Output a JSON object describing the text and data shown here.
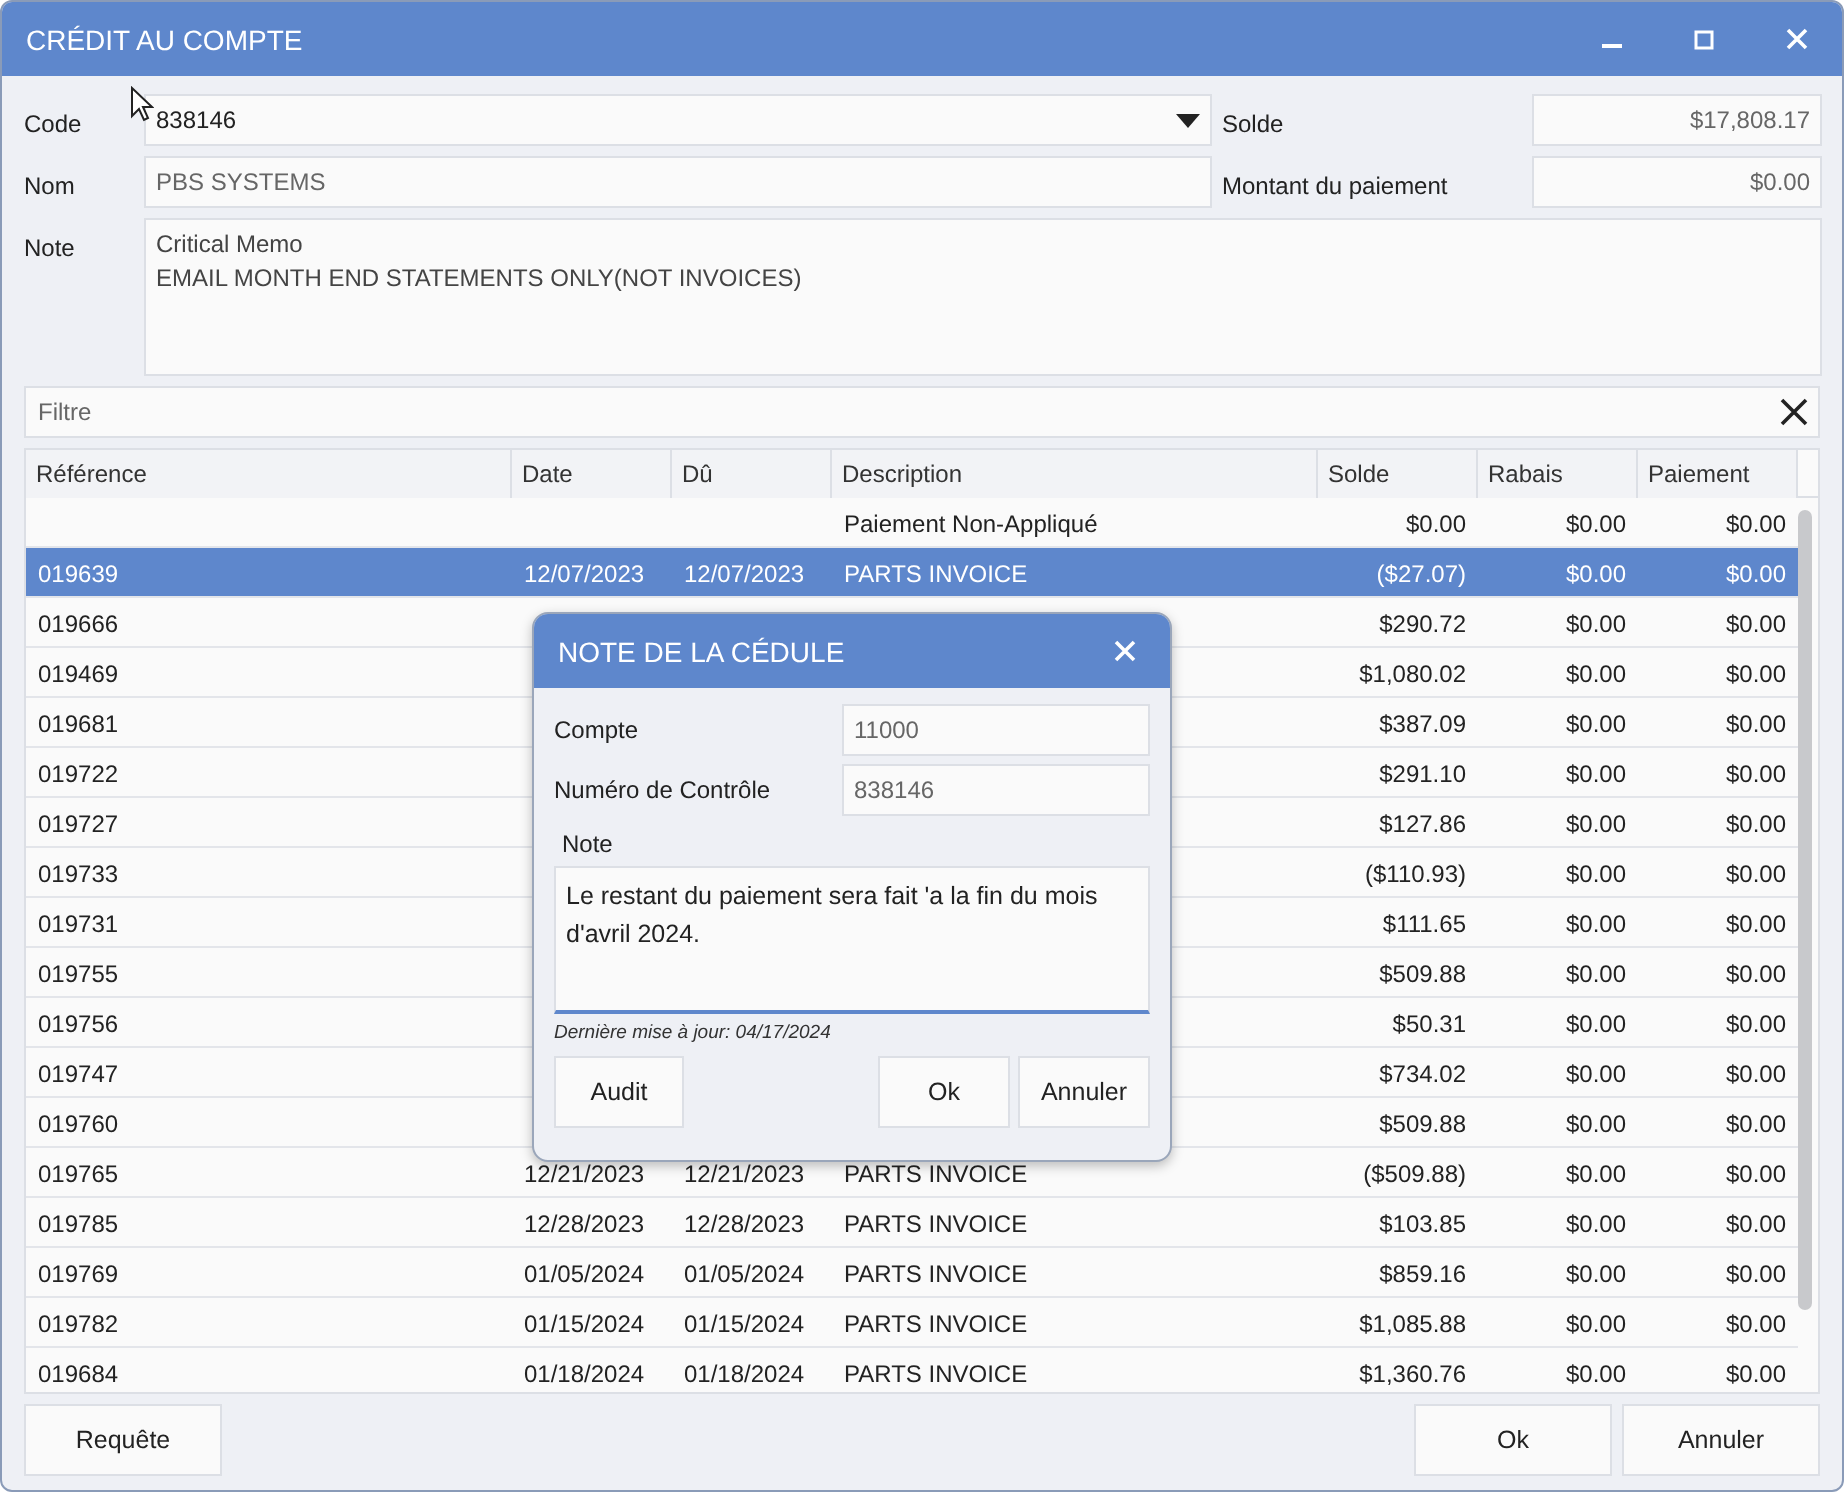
{
  "window": {
    "title": "CRÉDIT AU COMPTE"
  },
  "form": {
    "code_label": "Code",
    "code_value": "838146",
    "solde_label": "Solde",
    "solde_value": "$17,808.17",
    "nom_label": "Nom",
    "nom_value": "PBS SYSTEMS",
    "montant_label": "Montant du paiement",
    "montant_value": "$0.00",
    "note_label": "Note",
    "note_lines": [
      "Critical Memo",
      "EMAIL MONTH END STATEMENTS ONLY(NOT INVOICES)"
    ]
  },
  "filter": {
    "placeholder": "Filtre"
  },
  "table": {
    "columns": [
      "Référence",
      "Date",
      "Dû",
      "Description",
      "Solde",
      "Rabais",
      "Paiement"
    ],
    "rows": [
      {
        "selected": false,
        "description": "Paiement Non-Appliqué",
        "solde": "$0.00",
        "rabais": "$0.00",
        "paiement": "$0.00"
      },
      {
        "selected": true,
        "reference": "019639",
        "date": "12/07/2023",
        "due": "12/07/2023",
        "description": "PARTS INVOICE",
        "solde": "($27.07)",
        "rabais": "$0.00",
        "paiement": "$0.00"
      },
      {
        "selected": false,
        "reference": "019666",
        "solde": "$290.72",
        "rabais": "$0.00",
        "paiement": "$0.00"
      },
      {
        "selected": false,
        "reference": "019469",
        "solde": "$1,080.02",
        "rabais": "$0.00",
        "paiement": "$0.00"
      },
      {
        "selected": false,
        "reference": "019681",
        "solde": "$387.09",
        "rabais": "$0.00",
        "paiement": "$0.00"
      },
      {
        "selected": false,
        "reference": "019722",
        "solde": "$291.10",
        "rabais": "$0.00",
        "paiement": "$0.00"
      },
      {
        "selected": false,
        "reference": "019727",
        "solde": "$127.86",
        "rabais": "$0.00",
        "paiement": "$0.00"
      },
      {
        "selected": false,
        "reference": "019733",
        "solde": "($110.93)",
        "rabais": "$0.00",
        "paiement": "$0.00"
      },
      {
        "selected": false,
        "reference": "019731",
        "solde": "$111.65",
        "rabais": "$0.00",
        "paiement": "$0.00"
      },
      {
        "selected": false,
        "reference": "019755",
        "solde": "$509.88",
        "rabais": "$0.00",
        "paiement": "$0.00"
      },
      {
        "selected": false,
        "reference": "019756",
        "solde": "$50.31",
        "rabais": "$0.00",
        "paiement": "$0.00"
      },
      {
        "selected": false,
        "reference": "019747",
        "solde": "$734.02",
        "rabais": "$0.00",
        "paiement": "$0.00"
      },
      {
        "selected": false,
        "reference": "019760",
        "solde": "$509.88",
        "rabais": "$0.00",
        "paiement": "$0.00"
      },
      {
        "selected": false,
        "reference": "019765",
        "date": "12/21/2023",
        "due": "12/21/2023",
        "description": "PARTS INVOICE",
        "solde": "($509.88)",
        "rabais": "$0.00",
        "paiement": "$0.00"
      },
      {
        "selected": false,
        "reference": "019785",
        "date": "12/28/2023",
        "due": "12/28/2023",
        "description": "PARTS INVOICE",
        "solde": "$103.85",
        "rabais": "$0.00",
        "paiement": "$0.00"
      },
      {
        "selected": false,
        "reference": "019769",
        "date": "01/05/2024",
        "due": "01/05/2024",
        "description": "PARTS INVOICE",
        "solde": "$859.16",
        "rabais": "$0.00",
        "paiement": "$0.00"
      },
      {
        "selected": false,
        "reference": "019782",
        "date": "01/15/2024",
        "due": "01/15/2024",
        "description": "PARTS INVOICE",
        "solde": "$1,085.88",
        "rabais": "$0.00",
        "paiement": "$0.00"
      },
      {
        "selected": false,
        "reference": "019684",
        "date": "01/18/2024",
        "due": "01/18/2024",
        "description": "PARTS INVOICE",
        "solde": "$1,360.76",
        "rabais": "$0.00",
        "paiement": "$0.00"
      }
    ]
  },
  "footer": {
    "buttons": [
      "Requête",
      "Ok",
      "Annuler"
    ]
  },
  "dialog": {
    "title": "NOTE DE LA CÉDULE",
    "compte_label": "Compte",
    "compte_value": "11000",
    "controle_label": "Numéro de Contrôle",
    "controle_value": "838146",
    "note_label": "Note",
    "note_value": "Le restant du paiement sera fait 'a la fin du mois d'avril 2024.",
    "updated": "Dernière mise à jour: 04/17/2024",
    "buttons": [
      "Audit",
      "Ok",
      "Annuler"
    ]
  }
}
